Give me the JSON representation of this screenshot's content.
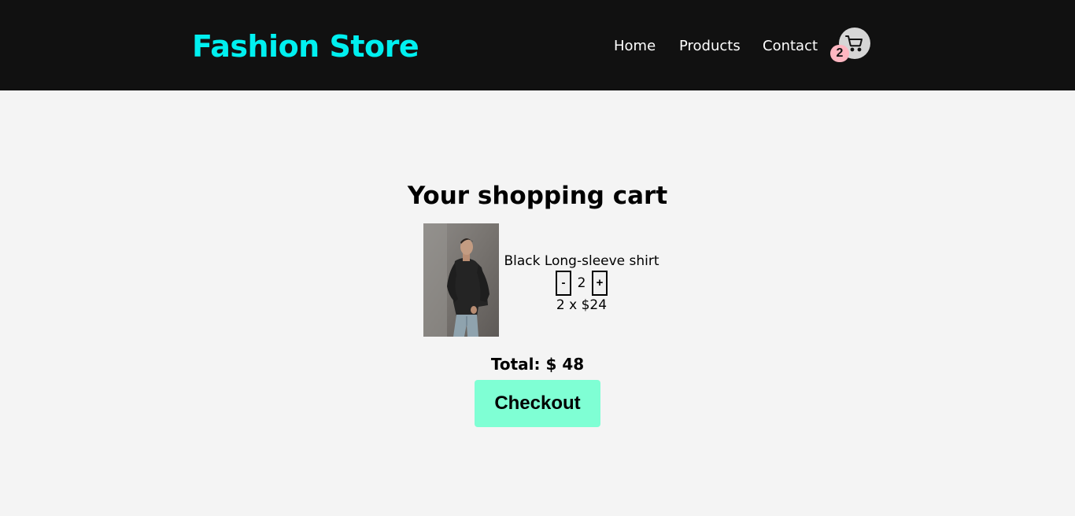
{
  "header": {
    "logo": "Fashion Store",
    "nav": {
      "home": "Home",
      "products": "Products",
      "contact": "Contact"
    },
    "cart_icon": "shopping-cart-icon",
    "cart_count": "2"
  },
  "cart": {
    "title": "Your shopping cart",
    "items": [
      {
        "name": "Black Long-sleeve shirt",
        "decrement_label": "-",
        "quantity": "2",
        "increment_label": "+",
        "price_line": "2 x $24"
      }
    ],
    "total": "Total: $ 48",
    "checkout_label": "Checkout"
  },
  "colors": {
    "header_bg": "#111111",
    "logo": "#00f0f0",
    "badge": "#ffb6c1",
    "checkout_bg": "#7fffd4",
    "page_bg": "#f4f4f4"
  }
}
